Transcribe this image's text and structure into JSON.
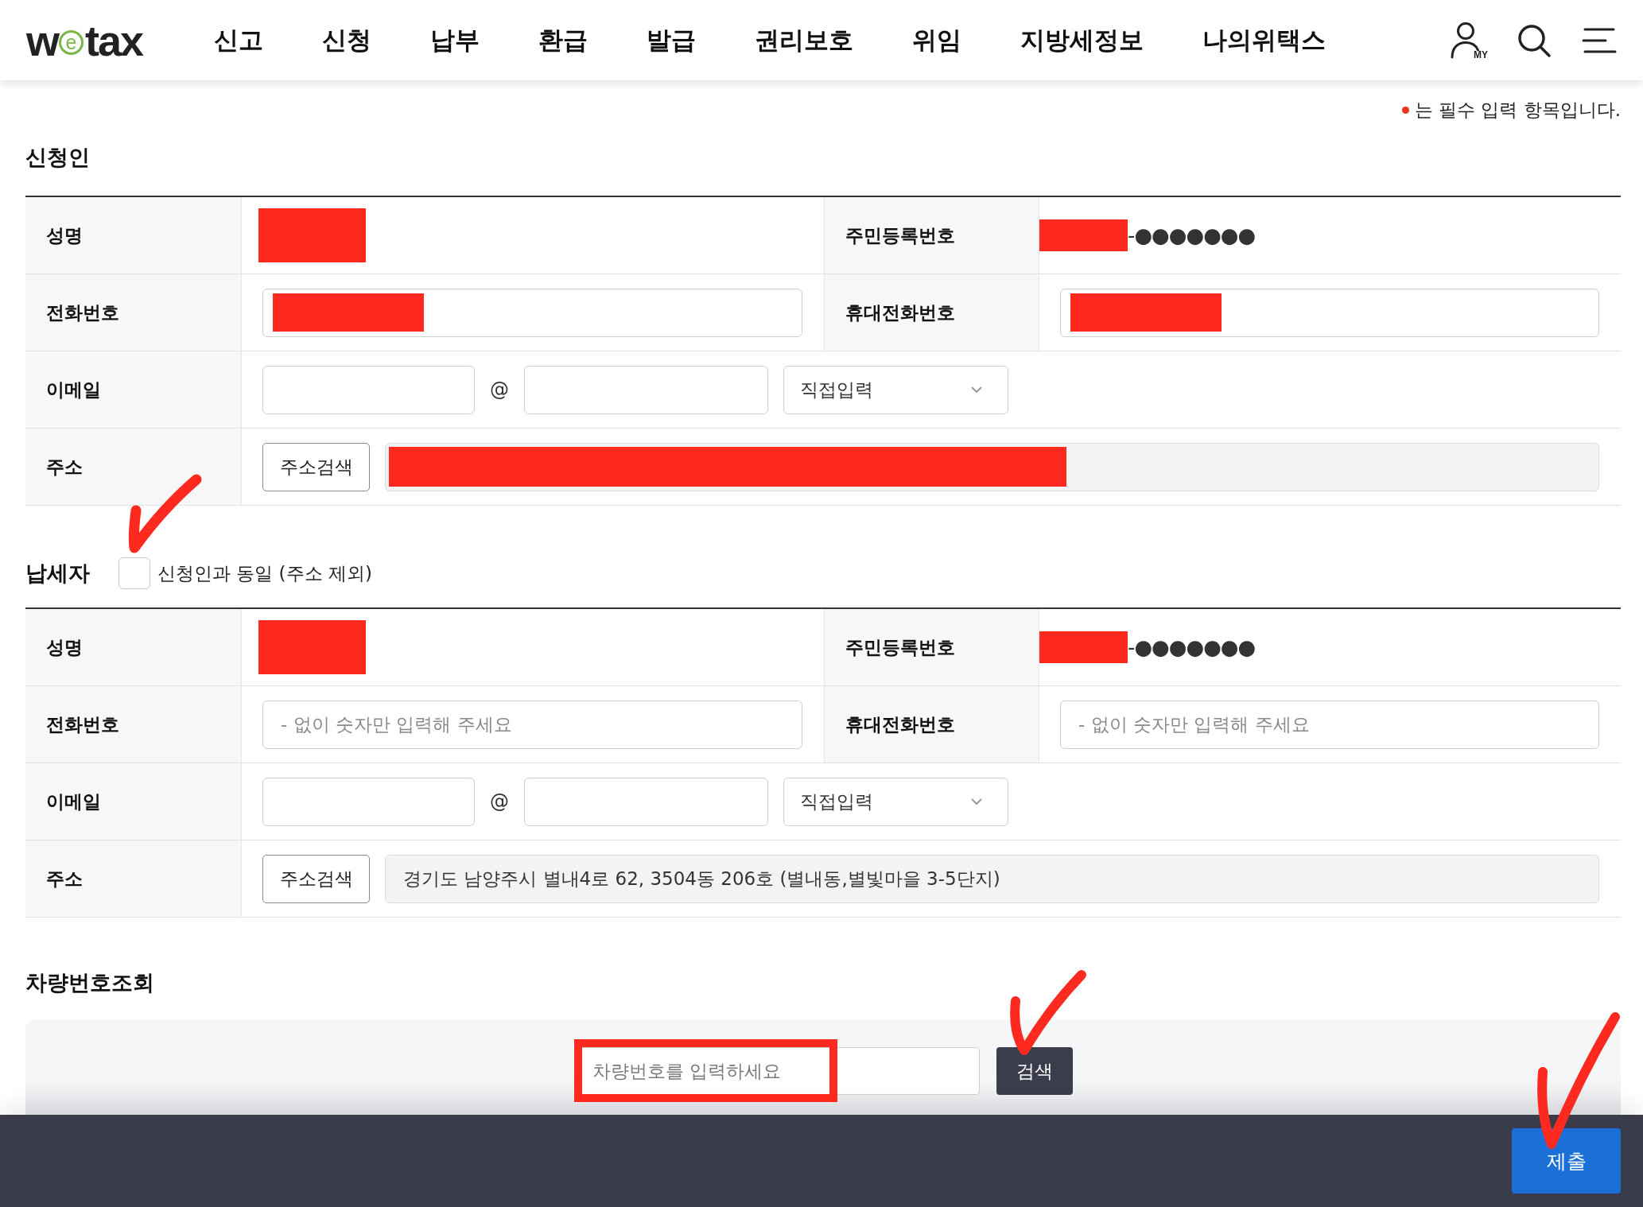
{
  "header": {
    "logo": [
      {
        "text": "w",
        "accent": false
      },
      {
        "text": "e",
        "accent": true
      },
      {
        "text": "tax",
        "accent": false
      }
    ],
    "nav": [
      "신고",
      "신청",
      "납부",
      "환급",
      "발급",
      "권리보호",
      "위임",
      "지방세정보",
      "나의위택스"
    ],
    "my_label": "MY"
  },
  "required_note": "는 필수 입력 항목입니다.",
  "sections": [
    {
      "title": "신청인",
      "rows": [
        [
          {
            "label": "성명",
            "kind": "text",
            "redacted": true
          },
          {
            "label": "주민등록번호",
            "kind": "id",
            "redacted": true,
            "masked": "-●●●●●●●"
          }
        ],
        [
          {
            "label": "전화번호",
            "kind": "input",
            "redacted": true
          },
          {
            "label": "휴대전화번호",
            "kind": "input",
            "redacted": true
          }
        ],
        [
          {
            "label": "이메일",
            "kind": "email",
            "redacted": false,
            "separator": "@",
            "domain": "직접입력"
          }
        ],
        [
          {
            "label": "주소",
            "kind": "address",
            "redacted": true,
            "button": "주소검색"
          }
        ]
      ]
    },
    {
      "title": "납세자",
      "same_as": {
        "label": "신청인과 동일 (주소 제외)",
        "checked": false,
        "marked": true
      },
      "rows": [
        [
          {
            "label": "성명",
            "kind": "text",
            "redacted": true
          },
          {
            "label": "주민등록번호",
            "kind": "id",
            "redacted": true,
            "masked": "-●●●●●●●"
          }
        ],
        [
          {
            "label": "전화번호",
            "kind": "input",
            "redacted": false,
            "placeholder": "- 없이 숫자만 입력해 주세요"
          },
          {
            "label": "휴대전화번호",
            "kind": "input",
            "redacted": false,
            "placeholder": "- 없이 숫자만 입력해 주세요"
          }
        ],
        [
          {
            "label": "이메일",
            "kind": "email",
            "redacted": false,
            "separator": "@",
            "domain": "직접입력"
          }
        ],
        [
          {
            "label": "주소",
            "kind": "address",
            "redacted": false,
            "button": "주소검색",
            "value": "경기도 남양주시 별내4로 62, 3504동 206호 (별내동,별빛마을 3-5단지)"
          }
        ]
      ]
    }
  ],
  "vehicle_search": {
    "title": "차량번호조회",
    "placeholder": "차량번호를 입력하세요",
    "framed": true,
    "button": {
      "label": "검색",
      "marked": true
    }
  },
  "footer": {
    "submit": {
      "label": "제출",
      "marked": true
    }
  }
}
